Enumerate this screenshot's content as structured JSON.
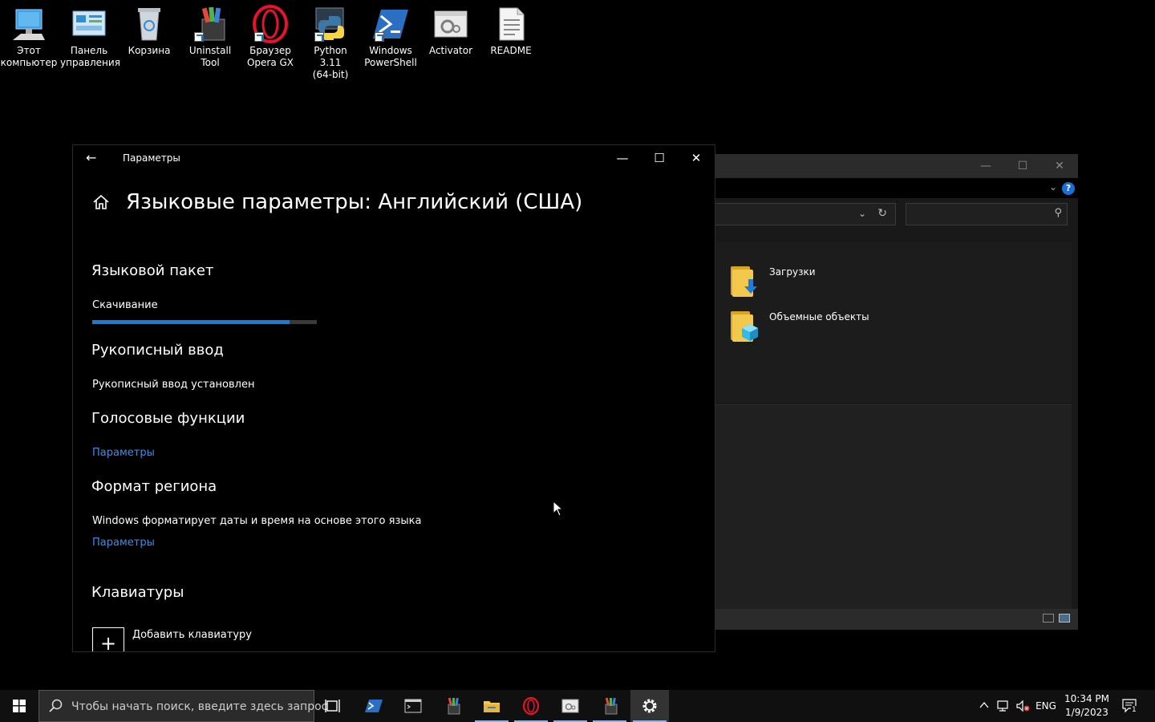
{
  "desktop": {
    "icons": [
      {
        "label": "Этот\nкомпьютер",
        "icon": "this-pc-icon"
      },
      {
        "label": "Панель\nуправления",
        "icon": "control-panel-icon"
      },
      {
        "label": "Корзина",
        "icon": "recycle-bin-icon"
      },
      {
        "label": "Uninstall Tool",
        "icon": "uninstall-tool-icon"
      },
      {
        "label": "Браузер\nOpera GX",
        "icon": "opera-gx-icon"
      },
      {
        "label": "Python 3.11\n(64-bit)",
        "icon": "python-icon"
      },
      {
        "label": "Windows\nPowerShell",
        "icon": "powershell-icon"
      },
      {
        "label": "Activator",
        "icon": "activator-icon"
      },
      {
        "label": "README",
        "icon": "text-document-icon"
      }
    ]
  },
  "settings": {
    "app_title": "Параметры",
    "page_title": "Языковые параметры: Английский (США)",
    "language_pack": {
      "heading": "Языковой пакет",
      "status": "Скачивание",
      "progress_percent": 88
    },
    "handwriting": {
      "heading": "Рукописный ввод",
      "status": "Рукописный ввод установлен"
    },
    "speech": {
      "heading": "Голосовые функции",
      "link": "Параметры"
    },
    "region_format": {
      "heading": "Формат региона",
      "description": "Windows форматирует даты и время на основе этого языка",
      "link": "Параметры"
    },
    "keyboards": {
      "heading": "Клавиатуры",
      "add_label": "Добавить клавиатуру"
    }
  },
  "explorer": {
    "folders": [
      {
        "name": "Загрузки",
        "icon": "downloads-folder-icon"
      },
      {
        "name": "Объемные объекты",
        "icon": "3d-objects-folder-icon"
      }
    ]
  },
  "taskbar": {
    "search_placeholder": "Чтобы начать поиск, введите здесь запрос",
    "language": "ENG",
    "time": "10:34 PM",
    "date": "1/9/2023",
    "notification_count": "1"
  },
  "colors": {
    "accent": "#1a7ad9",
    "link": "#3b8ee6",
    "taskbar": "#101010",
    "window_bg": "#000000"
  }
}
